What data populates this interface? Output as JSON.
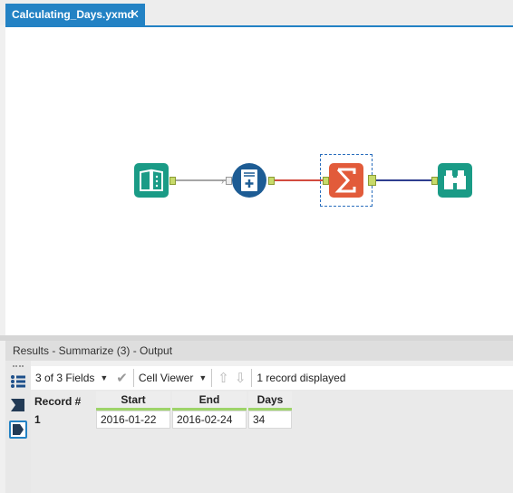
{
  "tab": {
    "title": "Calculating_Days.yxmd",
    "close": "✕"
  },
  "workflow": {
    "tools": [
      {
        "name": "Input"
      },
      {
        "name": "Formula"
      },
      {
        "name": "Summarize"
      },
      {
        "name": "Browse"
      }
    ],
    "colors": {
      "input": "#1a9b86",
      "formula": "#1d5c94",
      "summarize": "#e25b3a",
      "browse": "#1a9b86",
      "wire1": "#888888",
      "wire2": "#d24b3f",
      "wire3": "#2f3d8f"
    }
  },
  "results": {
    "title": "Results - Summarize (3) - Output",
    "fields_label": "3 of 3 Fields",
    "viewer_label": "Cell Viewer",
    "record_count": "1 record displayed",
    "columns": [
      "Record #",
      "Start",
      "End",
      "Days"
    ],
    "rows": [
      {
        "record": "1",
        "start": "2016-01-22",
        "end": "2016-02-24",
        "days": "34"
      }
    ]
  }
}
